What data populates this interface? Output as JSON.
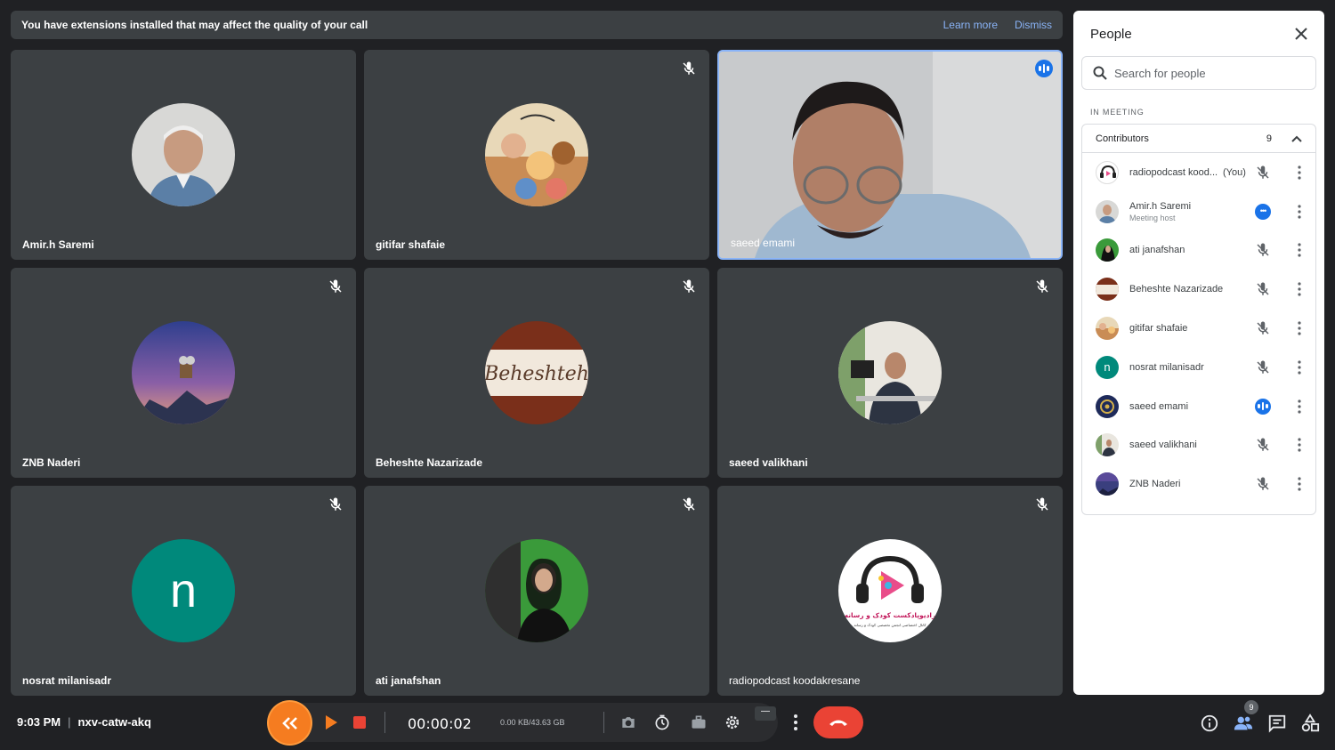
{
  "banner": {
    "message": "You have extensions installed that may affect the quality of your call",
    "learn_more": "Learn more",
    "dismiss": "Dismiss"
  },
  "tiles": [
    {
      "name": "Amir.h Saremi"
    },
    {
      "name": "gitifar shafaie"
    },
    {
      "name": "saeed emami"
    },
    {
      "name": "ZNB Naderi"
    },
    {
      "name": "Beheshte Nazarizade"
    },
    {
      "name": "saeed valikhani"
    },
    {
      "name": "nosrat milanisadr",
      "initial": "n"
    },
    {
      "name": "ati janafshan"
    },
    {
      "name": "radiopodcast koodakresane"
    }
  ],
  "logo_text": "رادیوپادکست کودک و رسانه",
  "logo_subtext": "کانال اختصاصی انجمن تخصصی کودک و رسانه",
  "beheshte_avatar_text": "Beheshteh",
  "panel": {
    "title": "People",
    "search_placeholder": "Search for people",
    "in_meeting": "IN MEETING",
    "contributors_label": "Contributors",
    "contributors_count": "9",
    "people": [
      {
        "name": "radiopodcast kood...",
        "you": "(You)"
      },
      {
        "name": "Amir.h Saremi",
        "role": "Meeting host"
      },
      {
        "name": "ati janafshan"
      },
      {
        "name": "Beheshte Nazarizade"
      },
      {
        "name": "gitifar shafaie"
      },
      {
        "name": "nosrat milanisadr",
        "initial": "n"
      },
      {
        "name": "saeed emami"
      },
      {
        "name": "saeed valikhani"
      },
      {
        "name": "ZNB Naderi"
      }
    ]
  },
  "bottom": {
    "time": "9:03 PM",
    "separator": "|",
    "meeting_code": "nxv-catw-akq",
    "rec_timer": "00:00:02",
    "rec_size": "0.00 KB/43.63 GB",
    "people_badge": "9",
    "minimize": "—"
  },
  "colors": {
    "background": "#202124",
    "tile": "#3c4043",
    "accent_blue": "#1a73e8",
    "end_call": "#ea4335",
    "recorder_orange": "#f57c20",
    "teal_avatar": "#00897b"
  }
}
